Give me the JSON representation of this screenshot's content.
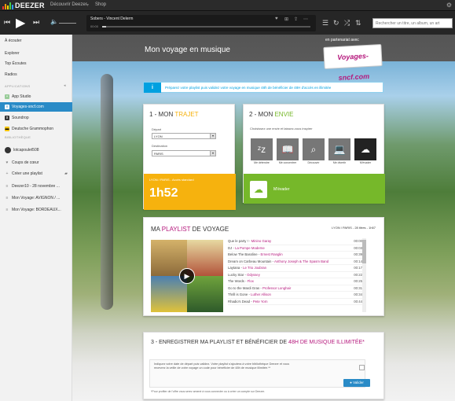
{
  "topbar": {
    "logo": "DEEZER",
    "nav": [
      "Découvrir Deezer",
      "Shop"
    ],
    "settings_icon": "gear-icon"
  },
  "player": {
    "track": "Sobers - Vincent Delerm",
    "time": "00:00",
    "progress": 0.02,
    "search_placeholder": "Rechercher un titre, un album, un art"
  },
  "sidebar": {
    "nav": [
      "À écouter",
      "Explorer",
      "Top Écoutes",
      "Radios"
    ],
    "apps_header": "APPLICATIONS",
    "apps": [
      "App Studio",
      "Voyages-sncf.com",
      "Soundrop",
      "Deutsche Grammophon"
    ],
    "library_header": "BIBLIOTHÈQUE",
    "user": "lotcapoulet508",
    "favorites": "Coups de cœur",
    "create_playlist": "Créer une playlist",
    "playlists": [
      "Deezer10 - 28 novembre ...",
      "Mon Voyage: AVIGNON / ...",
      "Mon Voyage: BORDEAUX..."
    ]
  },
  "header": {
    "title": "Mon voyage en musique",
    "partner_text": "en partenariat avec",
    "partner_logo": "Voyages-sncf.com"
  },
  "info": {
    "icon": "i",
    "text": "Préparez votre playlist puis validez votre voyage en musique 48h de bénéficier de 48H d'accès en illimitée"
  },
  "step1": {
    "title_a": "1 - MON ",
    "title_b": "TRAJET",
    "depart_label": "Départ",
    "depart_value": "LYON",
    "dest_label": "Destination",
    "dest_value": "PARIS",
    "route": "LYON / PARIS - Accès standard",
    "duration": "1h52"
  },
  "step2": {
    "title_a": "2 - MON ",
    "title_b": "ENVIE",
    "prompt": "Choisissez une envie et laissez-vous inspirer",
    "moods": [
      {
        "icon": "zz",
        "label": "Me détendre"
      },
      {
        "icon": "book",
        "label": "Me concentrer"
      },
      {
        "icon": "magnifier",
        "label": "Découvrir"
      },
      {
        "icon": "laptop",
        "label": "Me divertir"
      },
      {
        "icon": "cloud",
        "label": "M'évader"
      }
    ],
    "selected": "M'évader"
  },
  "playlist": {
    "title_a": "MA ",
    "title_b": "PLAYLIST",
    "title_c": " DE VOYAGE",
    "meta": "LYON / PARIS - 28 titres - 1h57",
    "tracks": [
      {
        "title": "Que le party ! - ",
        "artist": "Minino Garay",
        "dur": "00:00"
      },
      {
        "title": "DJ - ",
        "artist": "La Pompe Moderne",
        "dur": "00:03"
      },
      {
        "title": "Below The Bassline - ",
        "artist": "Ernest Ranglin",
        "dur": "00:39"
      },
      {
        "title": "Dream on Carbeau Mountain - ",
        "artist": "Anthony Joseph & The Spasm Band",
        "dur": "00:14"
      },
      {
        "title": "Laytana - ",
        "artist": "Le Trio Joubran",
        "dur": "00:17"
      },
      {
        "title": "Lucky Star - ",
        "artist": "Odyssey",
        "dur": "00:22"
      },
      {
        "title": "The Words - ",
        "artist": "Flox",
        "dur": "00:25"
      },
      {
        "title": "Go to the Mardi Gras - ",
        "artist": "Professor Longhair",
        "dur": "00:31"
      },
      {
        "title": "Thrill is Gone - ",
        "artist": "Luther Allison",
        "dur": "00:34"
      },
      {
        "title": "Rhadio's Dead - ",
        "artist": "Pete Yorn",
        "dur": "00:44"
      }
    ]
  },
  "step3": {
    "title_a": "3 - ENREGISTRER MA PLAYLIST ET BÉNÉFICIER DE ",
    "title_b": "48H DE MUSIQUE ILLIMITÉE*",
    "text": "Indiquez votre date de départ puis validez. Votre playlist s'ajoutera à votre bibliothèque Deezer et vous recevrez la veille de votre voyage un code pour bénéficier de 48h de musique illimitée.**",
    "button": "Valider",
    "footnote": "*Pour profiter de l'offre vous serez amené à vous connecter ou à créer un compte sur Deezer."
  }
}
